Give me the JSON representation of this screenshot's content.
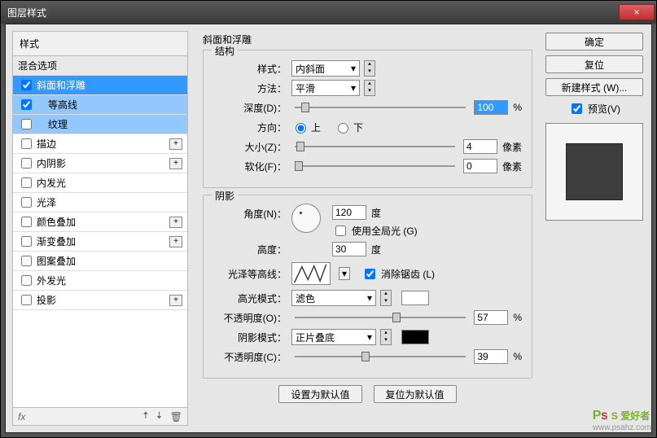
{
  "window": {
    "title": "图层样式",
    "close": "×"
  },
  "left": {
    "header": "样式",
    "blend": "混合选项",
    "items": [
      {
        "label": "斜面和浮雕",
        "checked": true,
        "sel": "main"
      },
      {
        "label": "等高线",
        "checked": true,
        "sel": "sub",
        "indent": true
      },
      {
        "label": "纹理",
        "checked": false,
        "sel": "sub",
        "indent": true
      },
      {
        "label": "描边",
        "checked": false,
        "add": true
      },
      {
        "label": "内阴影",
        "checked": false,
        "add": true
      },
      {
        "label": "内发光",
        "checked": false
      },
      {
        "label": "光泽",
        "checked": false
      },
      {
        "label": "颜色叠加",
        "checked": false,
        "add": true
      },
      {
        "label": "渐变叠加",
        "checked": false,
        "add": true
      },
      {
        "label": "图案叠加",
        "checked": false
      },
      {
        "label": "外发光",
        "checked": false
      },
      {
        "label": "投影",
        "checked": false,
        "add": true
      }
    ],
    "fx": "fx"
  },
  "mid": {
    "title": "斜面和浮雕",
    "structure": {
      "legend": "结构",
      "style_lbl": "样式：",
      "style_val": "内斜面",
      "method_lbl": "方法：",
      "method_val": "平滑",
      "depth_lbl": "深度(D)：",
      "depth_val": "100",
      "pct": "%",
      "dir_lbl": "方向：",
      "up": "上",
      "down": "下",
      "size_lbl": "大小(Z)：",
      "size_val": "4",
      "px": "像素",
      "soft_lbl": "软化(F)：",
      "soft_val": "0"
    },
    "shadow": {
      "legend": "阴影",
      "angle_lbl": "角度(N)：",
      "angle_val": "120",
      "deg": "度",
      "global": "使用全局光 (G)",
      "alt_lbl": "高度：",
      "alt_val": "30",
      "gloss_lbl": "光泽等高线：",
      "antialias": "消除锯齿 (L)",
      "hmode_lbl": "高光模式：",
      "hmode_val": "滤色",
      "hop_lbl": "不透明度(O)：",
      "hop_val": "57",
      "pct": "%",
      "smode_lbl": "阴影模式：",
      "smode_val": "正片叠底",
      "sop_lbl": "不透明度(C)：",
      "sop_val": "39"
    },
    "set_default": "设置为默认值",
    "reset_default": "复位为默认值"
  },
  "right": {
    "ok": "确定",
    "reset": "复位",
    "newstyle": "新建样式 (W)...",
    "preview": "预览(V)"
  },
  "watermark": {
    "brand": "S 爱好者",
    "url": "www.psahz.com"
  }
}
